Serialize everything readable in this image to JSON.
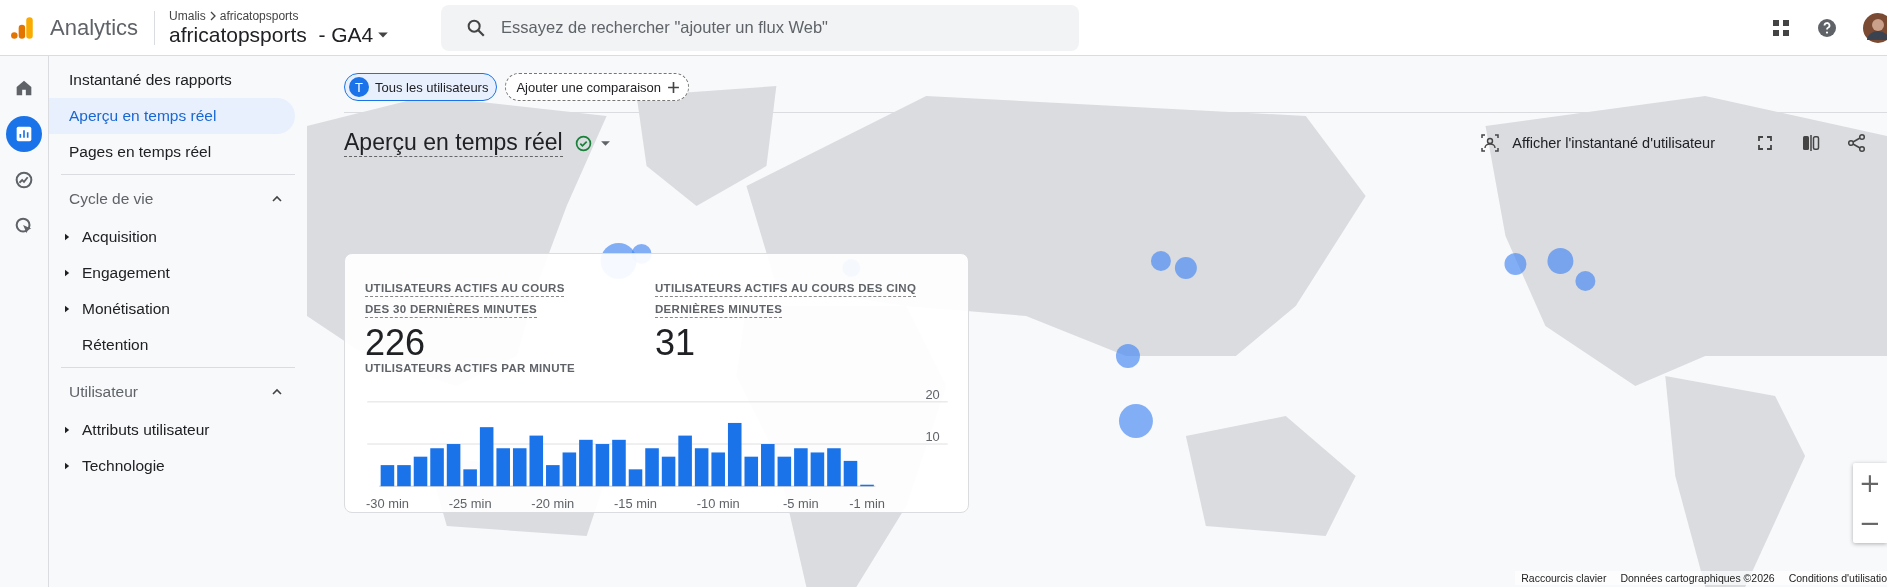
{
  "app": {
    "name": "Analytics"
  },
  "breadcrumb": {
    "account": "Umalis",
    "property": "africatopsports"
  },
  "property_selector": {
    "label": "africatopsports  - GA4"
  },
  "search": {
    "placeholder": "Essayez de rechercher \"ajouter un flux Web\""
  },
  "rail": [
    {
      "kind": "home",
      "selected": false
    },
    {
      "kind": "reports",
      "selected": true
    },
    {
      "kind": "explore",
      "selected": false
    },
    {
      "kind": "advertising",
      "selected": false
    }
  ],
  "sidebar": {
    "top_items": [
      {
        "label": "Instantané des rapports",
        "selected": false
      },
      {
        "label": "Aperçu en temps réel",
        "selected": true
      },
      {
        "label": "Pages en temps réel",
        "selected": false
      }
    ],
    "sections": [
      {
        "title": "Cycle de vie",
        "expanded": true,
        "items": [
          {
            "label": "Acquisition",
            "expandable": true
          },
          {
            "label": "Engagement",
            "expandable": true
          },
          {
            "label": "Monétisation",
            "expandable": true
          },
          {
            "label": "Rétention",
            "expandable": false
          }
        ]
      },
      {
        "title": "Utilisateur",
        "expanded": true,
        "items": [
          {
            "label": "Attributs utilisateur",
            "expandable": true
          },
          {
            "label": "Technologie",
            "expandable": true
          }
        ]
      }
    ]
  },
  "segments": [
    {
      "kind": "segment",
      "badge": "T",
      "label": "Tous les utilisateurs"
    },
    {
      "kind": "add",
      "label": "Ajouter une comparaison"
    }
  ],
  "report": {
    "title": "Aperçu en temps réel",
    "snapshot_button": "Afficher l'instantané d'utilisateur"
  },
  "card": {
    "metrics": [
      {
        "label": "UTILISATEURS ACTIFS AU COURS DES 30 DERNIÈRES MINUTES",
        "value": "226"
      },
      {
        "label": "UTILISATEURS ACTIFS AU COURS DES CINQ DERNIÈRES MINUTES",
        "value": "31"
      }
    ],
    "chart_label": "UTILISATEURS ACTIFS PAR MINUTE",
    "chart_data": {
      "type": "bar",
      "x": [
        -30,
        -29,
        -28,
        -27,
        -26,
        -25,
        -24,
        -23,
        -22,
        -21,
        -20,
        -19,
        -18,
        -17,
        -16,
        -15,
        -14,
        -13,
        -12,
        -11,
        -10,
        -9,
        -8,
        -7,
        -6,
        -5,
        -4,
        -3,
        -2,
        -1
      ],
      "series": [
        {
          "color": "#1a73e8",
          "values": [
            5,
            5,
            7,
            9,
            10,
            4,
            14,
            9,
            9,
            12,
            5,
            8,
            11,
            10,
            11,
            4,
            9,
            7,
            12,
            9,
            8,
            15,
            7,
            10,
            7,
            9,
            8,
            9,
            6,
            0
          ]
        }
      ],
      "xlim": [
        -30.5,
        -0.5
      ],
      "ylim": [
        0,
        20
      ],
      "yticks": [
        10,
        20
      ],
      "xticks": [
        {
          "value": -30,
          "label": "-30 min"
        },
        {
          "value": -25,
          "label": "-25 min"
        },
        {
          "value": -20,
          "label": "-20 min"
        },
        {
          "value": -15,
          "label": "-15 min"
        },
        {
          "value": -10,
          "label": "-10 min"
        },
        {
          "value": -5,
          "label": "-5 min"
        },
        {
          "value": -1,
          "label": "-1 min"
        }
      ]
    }
  },
  "map_footer": [
    "Raccourcis clavier",
    "Données cartographiques ©2026",
    "Conditions d'utilisatio"
  ],
  "zoom_controls": [
    "+",
    "−"
  ]
}
